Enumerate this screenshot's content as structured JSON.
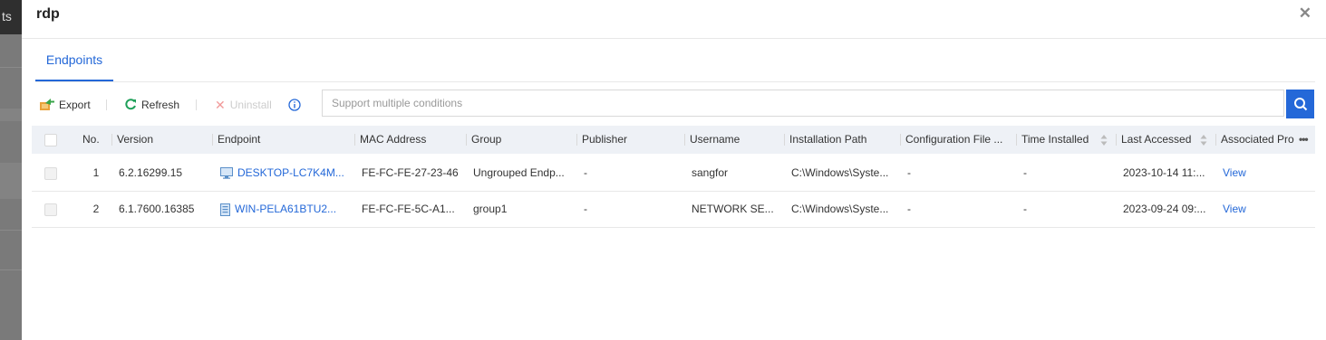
{
  "background": {
    "tab_fragment": "ts"
  },
  "dialog": {
    "title": "rdp",
    "close_icon": "close-icon"
  },
  "tabs": [
    {
      "label": "Endpoints",
      "active": true
    }
  ],
  "toolbar": {
    "export_label": "Export",
    "refresh_label": "Refresh",
    "uninstall_label": "Uninstall",
    "info_icon": "info-icon",
    "search_placeholder": "Support multiple conditions",
    "search_icon": "search-icon"
  },
  "table": {
    "columns": [
      "No.",
      "Version",
      "Endpoint",
      "MAC Address",
      "Group",
      "Publisher",
      "Username",
      "Installation Path",
      "Configuration File ...",
      "Time Installed",
      "Last Accessed",
      "Associated Pro"
    ],
    "more_icon": "ellipsis-icon",
    "rows": [
      {
        "no": "1",
        "version": "6.2.16299.15",
        "endpoint": "DESKTOP-LC7K4M...",
        "endpoint_icon": "desktop-icon",
        "mac": "FE-FC-FE-27-23-46",
        "group": "Ungrouped Endp...",
        "publisher": "-",
        "username": "sangfor",
        "path": "C:\\Windows\\Syste...",
        "config": "-",
        "time_installed": "-",
        "last_accessed": "2023-10-14 11:...",
        "associated": "View"
      },
      {
        "no": "2",
        "version": "6.1.7600.16385",
        "endpoint": "WIN-PELA61BTU2...",
        "endpoint_icon": "server-icon",
        "mac": "FE-FC-FE-5C-A1...",
        "group": "group1",
        "publisher": "-",
        "username": "NETWORK SE...",
        "path": "C:\\Windows\\Syste...",
        "config": "-",
        "time_installed": "-",
        "last_accessed": "2023-09-24 09:...",
        "associated": "View"
      }
    ]
  },
  "colors": {
    "accent": "#2468d8",
    "header_bg": "#eef1f6"
  }
}
